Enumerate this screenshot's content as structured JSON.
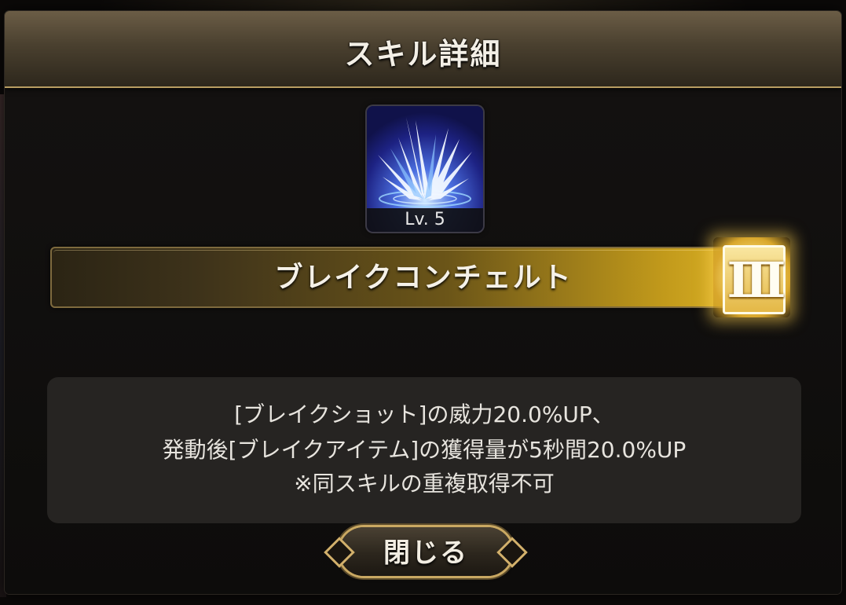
{
  "dialog": {
    "title": "スキル詳細"
  },
  "skill": {
    "icon": "ice-shards-icon",
    "level": "Lv. 5",
    "name": "ブレイクコンチェルト",
    "rank": "III",
    "description": [
      "[ブレイクショット]の威力20.0%UP、",
      "発動後[ブレイクアイテム]の獲得量が5秒間20.0%UP",
      "※同スキルの重複取得不可"
    ]
  },
  "close_button": {
    "label": "閉じる"
  },
  "colors": {
    "accent_gold": "#e5bb2a",
    "header_brown": "#4a402f",
    "icon_blue": "#2a3aa8"
  }
}
